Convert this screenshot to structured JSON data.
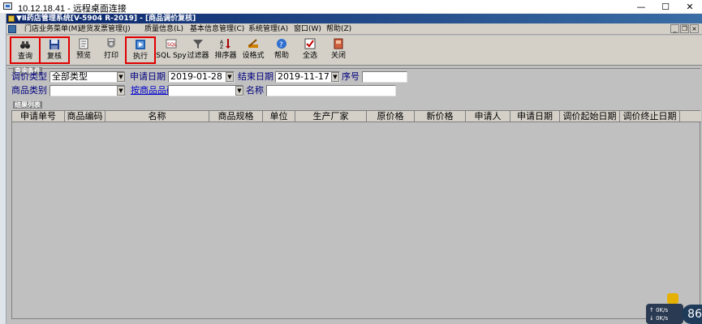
{
  "remote_window": {
    "title": "10.12.18.41 - 远程桌面连接",
    "minimize": "—",
    "maximize": "☐",
    "close": "✕"
  },
  "app": {
    "title": "▼Ⅱ药店管理系统[V-5904 R-2019] - [商品调价复核]"
  },
  "menu": {
    "items": [
      "门店业务菜单(M)",
      "进货发票管理(J)",
      "质量信息(L)",
      "基本信息管理(C)",
      "系统管理(A)",
      "窗口(W)",
      "帮助(Z)"
    ]
  },
  "toolbar": {
    "buttons": [
      {
        "label": "查询",
        "icon": "binoculars-icon"
      },
      {
        "label": "复核",
        "icon": "floppy-disk-icon"
      },
      {
        "label": "预览",
        "icon": "preview-icon"
      },
      {
        "label": "打印",
        "icon": "printer-icon"
      },
      {
        "label": "执行",
        "icon": "execute-icon"
      },
      {
        "label": "SQL Spy",
        "icon": "sql-spy-icon"
      },
      {
        "label": "过滤器",
        "icon": "funnel-icon"
      },
      {
        "label": "排序器",
        "icon": "sort-icon"
      },
      {
        "label": "设格式",
        "icon": "format-icon"
      },
      {
        "label": "帮助",
        "icon": "help-icon"
      },
      {
        "label": "全选",
        "icon": "check-all-icon"
      },
      {
        "label": "关闭",
        "icon": "close-door-icon"
      }
    ]
  },
  "query": {
    "section_title": "查询条件",
    "price_type_label": "调价类型",
    "price_type_value": "全部类型",
    "apply_date_label": "申请日期",
    "apply_date_value": "2019-01-28",
    "end_date_label": "结束日期",
    "end_date_value": "2019-11-17",
    "serial_label": "序号",
    "serial_value": "",
    "category_label": "商品类别",
    "category_value": "",
    "code_link_label": "按商品品码",
    "code_value": "",
    "name_label": "名称",
    "name_value": ""
  },
  "results": {
    "section_title": "结果列表",
    "columns": [
      "申请单号",
      "商品编码",
      "名称",
      "商品规格",
      "单位",
      "生产厂家",
      "原价格",
      "新价格",
      "申请人",
      "申请日期",
      "调价起始日期",
      "调价终止日期"
    ]
  },
  "overlay": {
    "upload_speed": "↑ 0K/s",
    "download_speed": "↓ 0K/s",
    "badge": "86"
  },
  "colors": {
    "app_titlebar": "#0a246a",
    "highlight_border": "#e00000",
    "grid_background": "#c0c0c0",
    "label_text": "#000080"
  }
}
